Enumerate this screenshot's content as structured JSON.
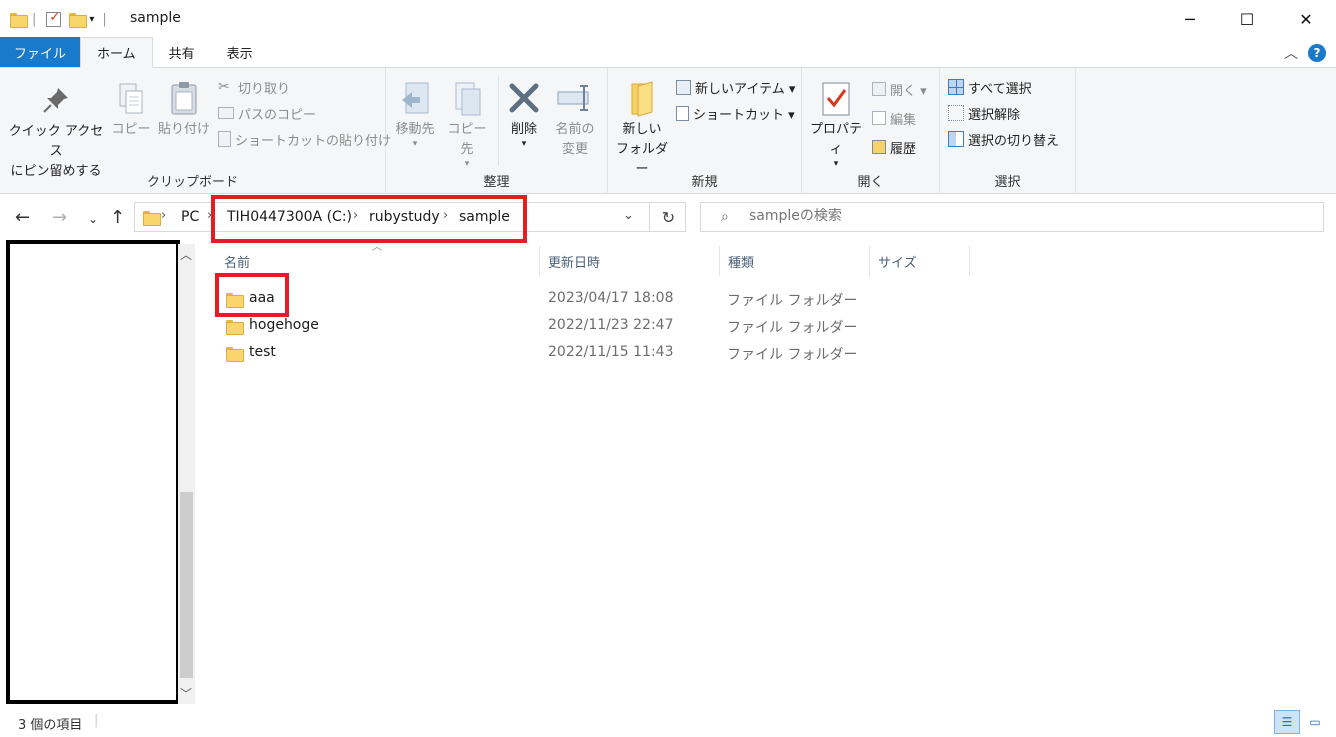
{
  "window": {
    "title": "sample",
    "minimize": "─",
    "maximize": "☐",
    "close": "✕"
  },
  "ribbon_tabs": [
    {
      "label": "ファイル"
    },
    {
      "label": "ホーム"
    },
    {
      "label": "共有"
    },
    {
      "label": "表示"
    }
  ],
  "ribbon": {
    "clipboard": {
      "label": "クリップボード",
      "pin_line1": "クイック アクセス",
      "pin_line2": "にピン留めする",
      "copy": "コピー",
      "paste": "貼り付け",
      "cut": "切り取り",
      "copy_path": "パスのコピー",
      "paste_shortcut": "ショートカットの貼り付け"
    },
    "organize": {
      "label": "整理",
      "move_to": "移動先",
      "copy_to": "コピー先",
      "delete": "削除",
      "rename_line1": "名前の",
      "rename_line2": "変更"
    },
    "new": {
      "label": "新規",
      "new_folder_line1": "新しい",
      "new_folder_line2": "フォルダー",
      "new_item": "新しいアイテム ▾",
      "shortcut": "ショートカット ▾"
    },
    "open": {
      "label": "開く",
      "properties": "プロパティ",
      "open": "開く ▾",
      "edit": "編集",
      "history": "履歴"
    },
    "select": {
      "label": "選択",
      "select_all": "すべて選択",
      "select_none": "選択解除",
      "invert": "選択の切り替え"
    }
  },
  "address": {
    "crumbs": [
      "PC",
      "TIH0447300A (C:)",
      "rubystudy",
      "sample"
    ]
  },
  "search": {
    "placeholder": "sampleの検索"
  },
  "columns": {
    "name": "名前",
    "date": "更新日時",
    "type": "種類",
    "size": "サイズ"
  },
  "files": [
    {
      "name": "aaa",
      "date": "2023/04/17 18:08",
      "type": "ファイル フォルダー"
    },
    {
      "name": "hogehoge",
      "date": "2022/11/23 22:47",
      "type": "ファイル フォルダー"
    },
    {
      "name": "test",
      "date": "2022/11/15 11:43",
      "type": "ファイル フォルダー"
    }
  ],
  "status": {
    "item_count": "3 個の項目"
  },
  "colors": {
    "file_tab": "#1979ca",
    "highlight": "#e51c23"
  }
}
